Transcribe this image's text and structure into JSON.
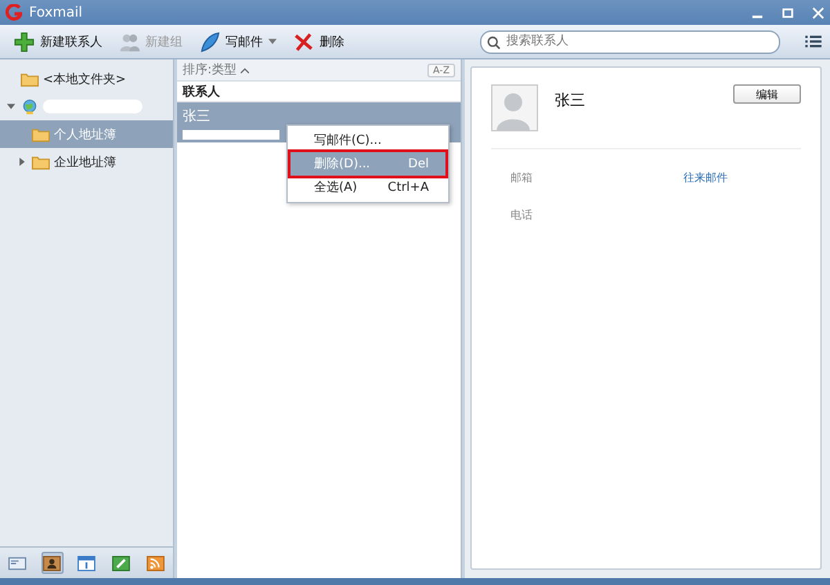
{
  "window": {
    "title": "Foxmail"
  },
  "toolbar": {
    "buttons": [
      {
        "kind": "add",
        "label": "新建联系人",
        "disabled": false,
        "dropdown": false
      },
      {
        "kind": "group",
        "label": "新建组",
        "disabled": true,
        "dropdown": false
      },
      {
        "kind": "compose",
        "label": "写邮件",
        "disabled": false,
        "dropdown": true
      },
      {
        "kind": "delete",
        "label": "删除",
        "disabled": false,
        "dropdown": false
      }
    ],
    "search": {
      "placeholder": "搜索联系人"
    }
  },
  "folders": [
    {
      "kind": "folder",
      "label": "<本地文件夹>",
      "selected": false
    },
    {
      "kind": "account",
      "selected": false,
      "expanded": true,
      "children": [
        {
          "kind": "folder",
          "label": "个人地址簿",
          "selected": true
        },
        {
          "kind": "folder",
          "label": "企业地址簿",
          "selected": false,
          "expanded": false
        }
      ]
    }
  ],
  "list": {
    "sort_label": "排序:类型",
    "sort_button": "A-Z",
    "group": "联系人",
    "contacts": [
      {
        "name": "张三",
        "selected": true
      }
    ]
  },
  "context_menu": {
    "items": [
      {
        "label": "写邮件(C)...",
        "selected": false,
        "annotated": false
      },
      {
        "label": "删除(D)...",
        "shortcut": "Del",
        "selected": true,
        "annotated": true
      },
      {
        "label": "全选(A)",
        "shortcut": "Ctrl+A",
        "selected": false,
        "annotated": false
      }
    ]
  },
  "detail": {
    "name": "张三",
    "edit_button": "编辑",
    "fields": [
      {
        "label": "邮箱",
        "link": "往来邮件"
      },
      {
        "label": "电话"
      }
    ]
  },
  "nav": [
    {
      "kind": "mail",
      "selected": false
    },
    {
      "kind": "contacts",
      "selected": true
    },
    {
      "kind": "calendar",
      "selected": false
    },
    {
      "kind": "notes",
      "selected": false
    },
    {
      "kind": "feeds",
      "selected": false
    }
  ]
}
